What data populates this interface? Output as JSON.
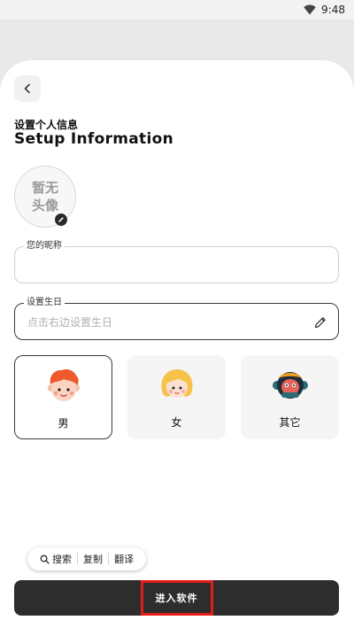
{
  "status_bar": {
    "time": "9:48",
    "icons": [
      "wifi-icon"
    ]
  },
  "header": {
    "back_icon": "chevron-left-icon",
    "title_cn": "设置个人信息",
    "title_en": "Setup Information"
  },
  "avatar": {
    "placeholder_text": "暂无头像",
    "edit_icon": "pencil-icon"
  },
  "nickname": {
    "label": "您的昵称",
    "value": "",
    "placeholder": ""
  },
  "birthday": {
    "label": "设置生日",
    "placeholder": "点击右边设置生日",
    "edit_icon": "pencil-icon"
  },
  "gender": {
    "options": [
      {
        "label": "男",
        "selected": true
      },
      {
        "label": "女",
        "selected": false
      },
      {
        "label": "其它",
        "selected": false
      }
    ]
  },
  "text_toolbar": {
    "search": "搜索",
    "copy": "复制",
    "translate": "翻译"
  },
  "footer": {
    "enter_label": "进入软件"
  },
  "colors": {
    "accent": "#2d2d2d",
    "highlight": "#e31b1b",
    "background": "#ffffff"
  }
}
